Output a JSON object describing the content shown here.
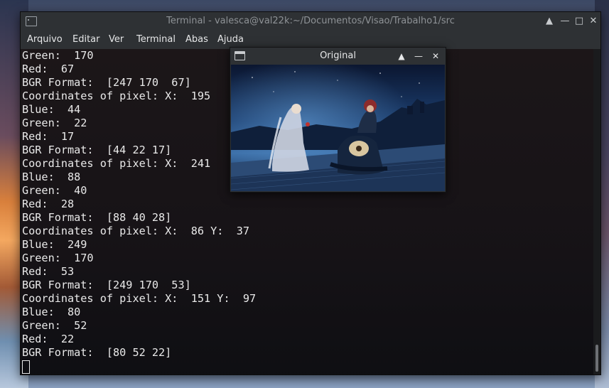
{
  "terminal": {
    "title": "Terminal - valesca@val22k:~/Documentos/Visao/Trabalho1/src",
    "controls": {
      "shade": "▲",
      "minimize": "—",
      "maximize": "□",
      "close": "✕"
    },
    "menu": [
      "Arquivo",
      "Editar",
      "Ver",
      "Terminal",
      "Abas",
      "Ajuda"
    ],
    "lines": [
      "Green:  170",
      "Red:  67",
      "BGR Format:  [247 170  67]",
      "Coordinates of pixel: X:  195",
      "Blue:  44",
      "Green:  22",
      "Red:  17",
      "BGR Format:  [44 22 17]",
      "Coordinates of pixel: X:  241",
      "Blue:  88",
      "Green:  40",
      "Red:  28",
      "BGR Format:  [88 40 28]",
      "Coordinates of pixel: X:  86 Y:  37",
      "Blue:  249",
      "Green:  170",
      "Red:  53",
      "BGR Format:  [249 170  53]",
      "Coordinates of pixel: X:  151 Y:  97",
      "Blue:  80",
      "Green:  52",
      "Red:  22",
      "BGR Format:  [80 52 22]"
    ]
  },
  "image_window": {
    "title": "Original",
    "controls": {
      "shade": "▲",
      "minimize": "—",
      "close": "✕"
    }
  },
  "colors": {
    "terminal_chrome": "#2e3134",
    "terminal_text": "#e9e9e9",
    "sky_dark": "#0e1a33",
    "sky_blue": "#2f5f95"
  }
}
